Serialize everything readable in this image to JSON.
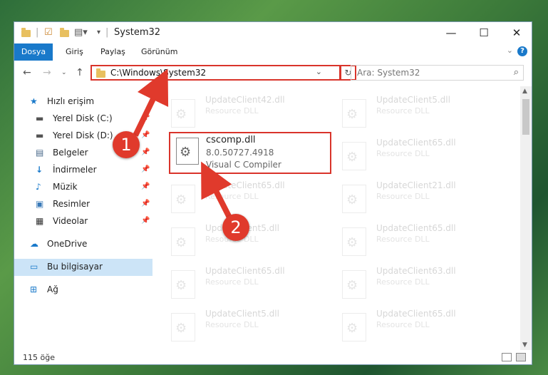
{
  "window": {
    "title": "System32"
  },
  "ribbon": {
    "tabs": [
      "Dosya",
      "Giriş",
      "Paylaş",
      "Görünüm"
    ],
    "help": "?"
  },
  "nav": {
    "address": "C:\\Windows\\System32",
    "search_placeholder": "Ara: System32"
  },
  "sidebar": {
    "items": [
      {
        "label": "Hızlı erişim",
        "icon": "star-icon"
      },
      {
        "label": "Yerel Disk (C:)",
        "icon": "drive-icon"
      },
      {
        "label": "Yerel Disk (D:)",
        "icon": "drive-icon"
      },
      {
        "label": "Belgeler",
        "icon": "documents-icon"
      },
      {
        "label": "İndirmeler",
        "icon": "download-icon"
      },
      {
        "label": "Müzik",
        "icon": "music-icon"
      },
      {
        "label": "Resimler",
        "icon": "pictures-icon"
      },
      {
        "label": "Videolar",
        "icon": "videos-icon"
      },
      {
        "label": "OneDrive",
        "icon": "cloud-icon"
      },
      {
        "label": "Bu bilgisayar",
        "icon": "computer-icon"
      },
      {
        "label": "Ağ",
        "icon": "network-icon"
      }
    ]
  },
  "files": [
    {
      "name": "UpdateClient42.dll",
      "desc": "Resource DLL"
    },
    {
      "name": "UpdateClient5.dll",
      "desc": "Resource DLL"
    },
    {
      "name": "UpdateClient65.dll",
      "desc": "Resource DLL"
    },
    {
      "name": "UpdateClient65.dll",
      "desc": "Resource DLL"
    },
    {
      "name": "UpdateClient21.dll",
      "desc": "Resource DLL"
    },
    {
      "name": "UpdateClient5.dll",
      "desc": "Resource DLL"
    },
    {
      "name": "UpdateClient65.dll",
      "desc": "Resource DLL"
    },
    {
      "name": "UpdateClient65.dll",
      "desc": "Resource DLL"
    },
    {
      "name": "UpdateClient63.dll",
      "desc": "Resource DLL"
    },
    {
      "name": "UpdateClient5.dll",
      "desc": "Resource DLL"
    },
    {
      "name": "UpdateClient65.dll",
      "desc": "Resource DLL"
    }
  ],
  "highlighted": {
    "name": "cscomp.dll",
    "version": "8.0.50727.4918",
    "desc": "Visual C Compiler"
  },
  "status": {
    "count": "115 öğe"
  },
  "badges": [
    "1",
    "2"
  ],
  "colors": {
    "accent": "#1979ca",
    "highlight": "#d9342b",
    "badge": "#e03a2c"
  }
}
